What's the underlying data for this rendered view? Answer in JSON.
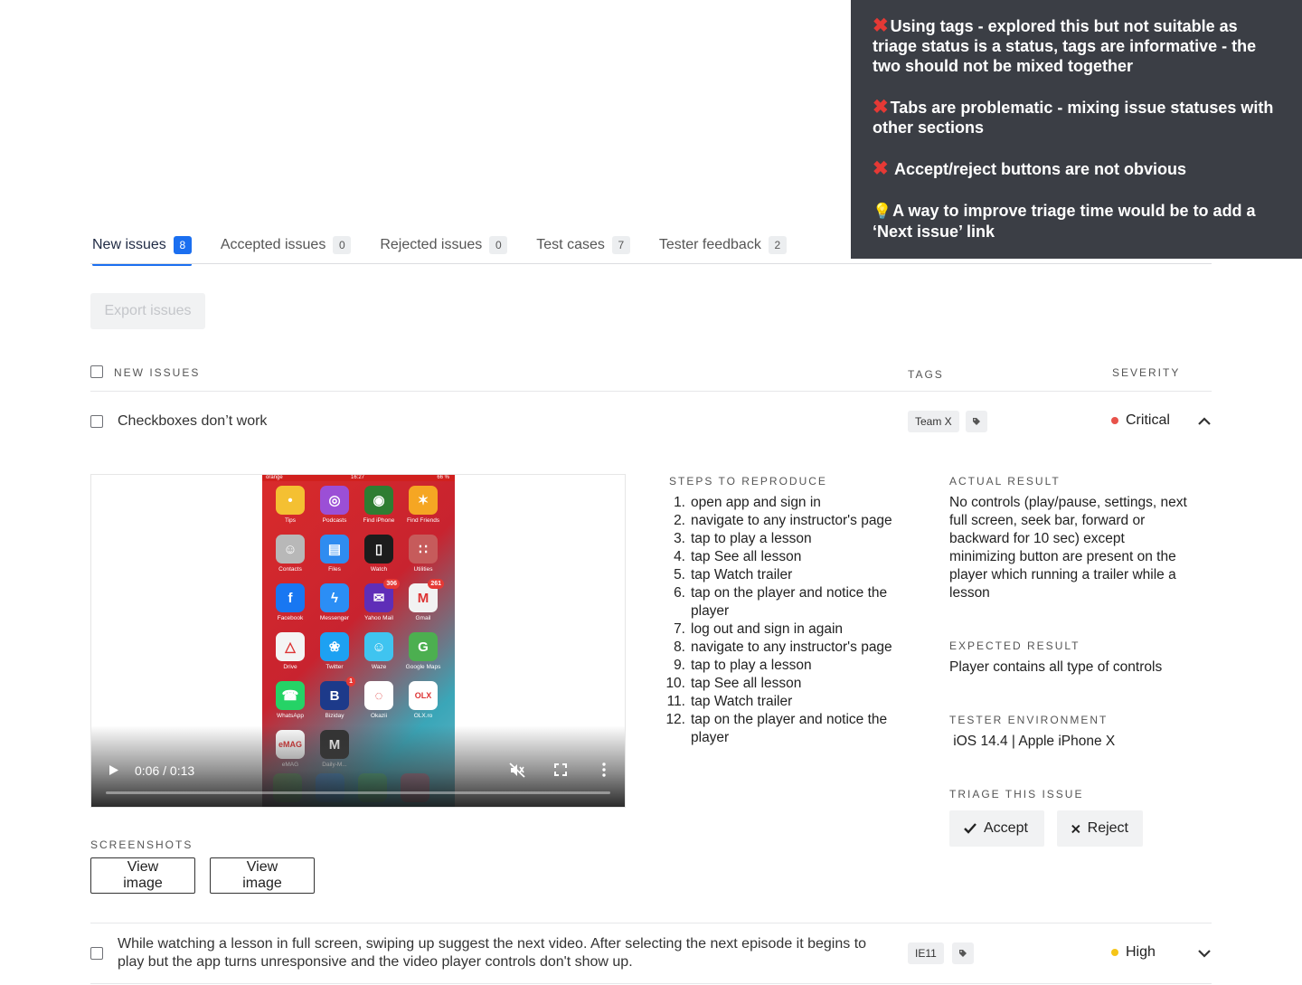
{
  "annotation": {
    "notes": [
      {
        "icon": "cross",
        "text": "Using tags - explored this but not suitable as triage status is a status, tags are informative - the two should not be mixed together"
      },
      {
        "icon": "cross",
        "text": "Tabs are problematic - mixing issue statuses with other sections"
      },
      {
        "icon": "cross",
        "text": " Accept/reject buttons are not obvious"
      },
      {
        "icon": "bulb",
        "text": "A way to improve triage time would be to add a ‘Next issue’ link"
      }
    ]
  },
  "tabs": [
    {
      "label": "New issues",
      "count": "8",
      "active": true
    },
    {
      "label": "Accepted issues",
      "count": "0",
      "active": false
    },
    {
      "label": "Rejected issues",
      "count": "0",
      "active": false
    },
    {
      "label": "Test cases",
      "count": "7",
      "active": false
    },
    {
      "label": "Tester feedback",
      "count": "2",
      "active": false
    }
  ],
  "toolbar": {
    "export_label": "Export issues"
  },
  "table": {
    "header_new": "NEW ISSUES",
    "header_tags": "TAGS",
    "header_severity": "SEVERITY"
  },
  "issues": [
    {
      "title": "Checkboxes don’t work",
      "tag": "Team X",
      "severity": "Critical",
      "severity_color": "#e8524a",
      "expanded": true
    },
    {
      "title": "While watching a lesson in full screen, swiping up suggest the next video. After selecting the next episode it begins to play but the app turns unresponsive and the video player controls don't show up.",
      "tag": "IE11",
      "severity": "High",
      "severity_color": "#f5c518",
      "expanded": false
    }
  ],
  "video": {
    "time": "0:06 / 0:13",
    "progress": 0.0,
    "phone_status": {
      "carrier": "orange",
      "time": "16:27",
      "battery": "66 %"
    },
    "apps": [
      {
        "label": "Tips",
        "color": "#f4c032",
        "glyph": "•"
      },
      {
        "label": "Podcasts",
        "color": "#9b4fd6",
        "glyph": "◎"
      },
      {
        "label": "Find iPhone",
        "color": "#2e7d32",
        "glyph": "◉"
      },
      {
        "label": "Find Friends",
        "color": "#f5a623",
        "glyph": "✶"
      },
      {
        "label": "Contacts",
        "color": "#b8b8b8",
        "glyph": "☺"
      },
      {
        "label": "Files",
        "color": "#2f8cf0",
        "glyph": "▤"
      },
      {
        "label": "Watch",
        "color": "#1c1c1c",
        "glyph": "▯"
      },
      {
        "label": "Utilities",
        "color": "#c65b5b",
        "glyph": "∷"
      },
      {
        "label": "Facebook",
        "color": "#1877f2",
        "glyph": "f"
      },
      {
        "label": "Messenger",
        "color": "#2b8ef5",
        "glyph": "ϟ"
      },
      {
        "label": "Yahoo Mail",
        "color": "#5f2eb8",
        "glyph": "✉",
        "badge": "306"
      },
      {
        "label": "Gmail",
        "color": "#f2f2f2",
        "glyph": "M",
        "badge": "261"
      },
      {
        "label": "Drive",
        "color": "#f4f4f4",
        "glyph": "△"
      },
      {
        "label": "Twitter",
        "color": "#1da1f2",
        "glyph": "❀"
      },
      {
        "label": "Waze",
        "color": "#3fc4f0",
        "glyph": "☺"
      },
      {
        "label": "Google Maps",
        "color": "#4caf50",
        "glyph": "G"
      },
      {
        "label": "WhatsApp",
        "color": "#25d366",
        "glyph": "☎"
      },
      {
        "label": "Biziday",
        "color": "#1d3a8a",
        "glyph": "B",
        "badge": "1"
      },
      {
        "label": "Okazii",
        "color": "#ffffff",
        "glyph": "◌"
      },
      {
        "label": "OLX.ro",
        "color": "#ffffff",
        "glyph": "OLX"
      },
      {
        "label": "eMAG",
        "color": "#ffffff",
        "glyph": "eMAG"
      },
      {
        "label": "Daily-M...",
        "color": "#333333",
        "glyph": "M"
      }
    ]
  },
  "screenshots": {
    "heading": "SCREENSHOTS",
    "buttons": [
      "View image",
      "View image"
    ]
  },
  "steps": {
    "heading": "STEPS TO REPRODUCE",
    "items": [
      "open app and sign in",
      "navigate to any instructor's page",
      "tap to play a lesson",
      "tap See all lesson",
      "tap Watch trailer",
      "tap on the player and notice the player",
      "log out and sign in again",
      "navigate to any instructor's page",
      "tap to play a lesson",
      "tap See all lesson",
      "tap Watch trailer",
      "tap on the player and notice the player"
    ]
  },
  "actual": {
    "heading": "ACTUAL RESULT",
    "text": "No controls (play/pause, settings, next full screen, seek bar, forward or backward for 10 sec) except minimizing button are present on the player which running a trailer while a lesson"
  },
  "expected": {
    "heading": "EXPECTED RESULT",
    "text": "Player contains all type of controls"
  },
  "environment": {
    "heading": "TESTER ENVIRONMENT",
    "text": " iOS 14.4 | Apple iPhone X"
  },
  "triage": {
    "heading": "TRIAGE THIS ISSUE",
    "accept_label": "Accept",
    "reject_label": "Reject"
  }
}
